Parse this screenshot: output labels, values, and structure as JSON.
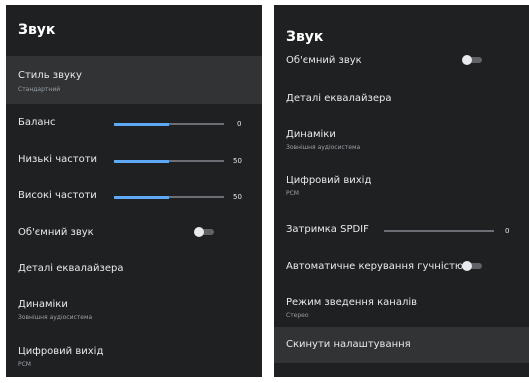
{
  "left": {
    "title": "Звук",
    "items": [
      {
        "label": "Стиль звуку",
        "sub": "Стандартний"
      },
      {
        "label": "Баланс",
        "value": "0",
        "level": 0.5
      },
      {
        "label": "Низькі частоти",
        "value": "50",
        "level": 0.5
      },
      {
        "label": "Високі частоти",
        "value": "50",
        "level": 0.5
      },
      {
        "label": "Об'ємний звук",
        "toggle": "off"
      },
      {
        "label": "Деталі еквалайзера"
      },
      {
        "label": "Динаміки",
        "sub": "Зовнішня аудіосистема"
      },
      {
        "label": "Цифровий вихід",
        "sub": "PCM"
      }
    ]
  },
  "right": {
    "title": "Звук",
    "items": [
      {
        "label": "Об'ємний звук",
        "toggle": "off"
      },
      {
        "label": "Деталі еквалайзера"
      },
      {
        "label": "Динаміки",
        "sub": "Зовнішня аудіосистема"
      },
      {
        "label": "Цифровий вихід",
        "sub": "PCM"
      },
      {
        "label": "Затримка SPDIF",
        "value": "0",
        "level": 0.0
      },
      {
        "label": "Автоматичне керування гучністю",
        "toggle": "off"
      },
      {
        "label": "Режим зведення каналів",
        "sub": "Стерео"
      },
      {
        "label": "Скинути налаштування"
      }
    ]
  }
}
